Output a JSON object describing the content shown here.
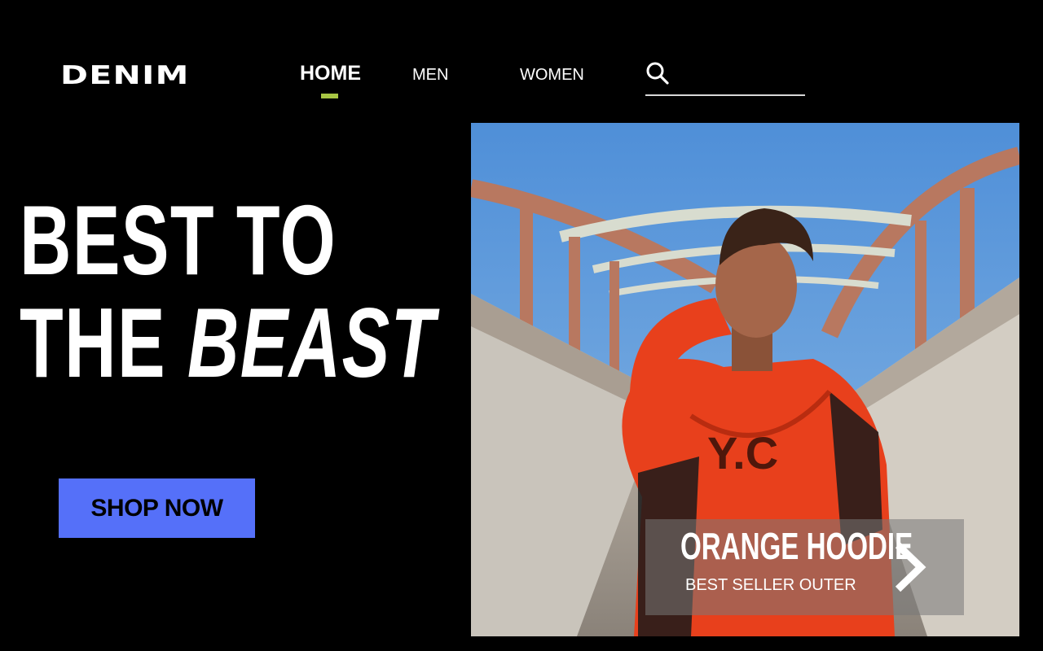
{
  "brand": {
    "logo": "DENIM"
  },
  "nav": {
    "items": [
      {
        "label": "HOME",
        "active": true
      },
      {
        "label": "MEN",
        "active": false
      },
      {
        "label": "WOMEN",
        "active": false
      }
    ],
    "active_indicator_color": "#a8c644"
  },
  "search": {
    "icon": "search-icon",
    "value": ""
  },
  "hero": {
    "headline_line1": "BEST TO",
    "headline_line2_plain": "THE",
    "headline_line2_italic": "BEAST",
    "cta_label": "SHOP NOW",
    "cta_color": "#5570f9"
  },
  "product_card": {
    "title": "ORANGE HOODIE",
    "subtitle": "BEST SELLER OUTER",
    "arrow_icon": "chevron-right-icon"
  }
}
